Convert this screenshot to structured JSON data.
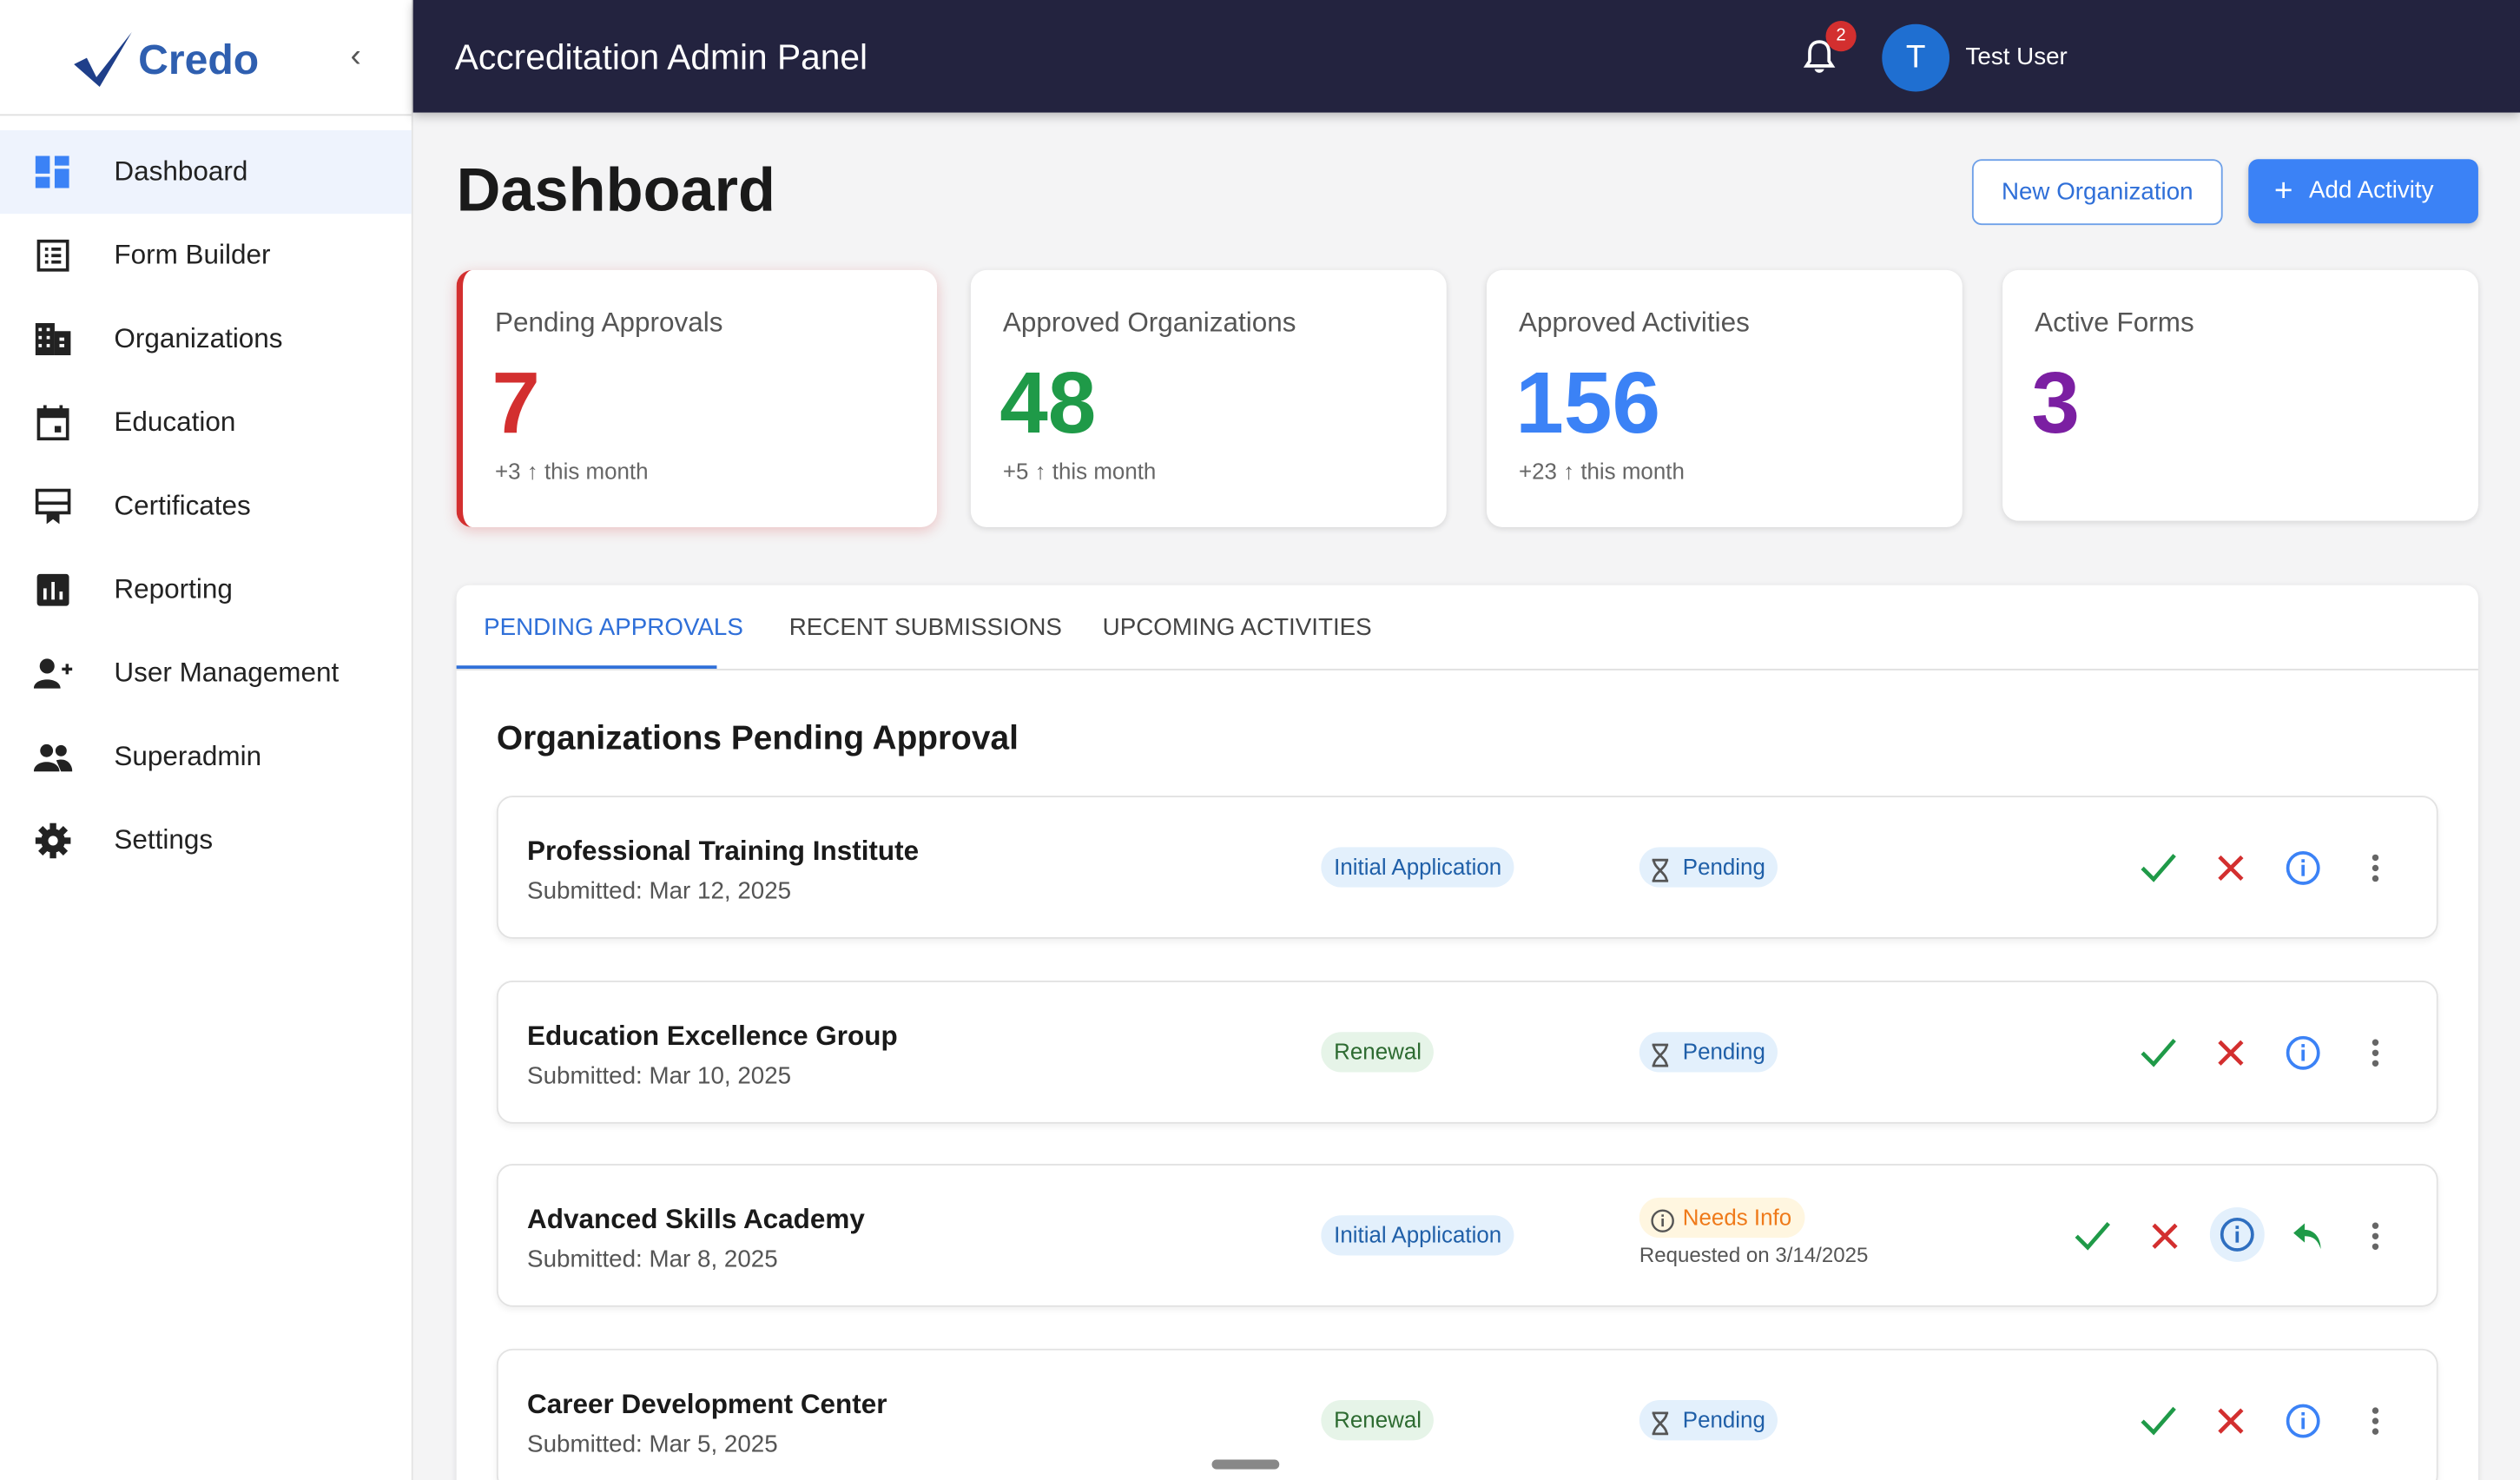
{
  "brand": {
    "name": "Credo"
  },
  "header": {
    "title": "Accreditation Admin Panel",
    "notifications": "2",
    "avatar_initial": "T",
    "user_name": "Test User"
  },
  "sidebar": {
    "items": [
      {
        "label": "Dashboard",
        "icon": "dashboard-icon",
        "active": true
      },
      {
        "label": "Form Builder",
        "icon": "form-icon"
      },
      {
        "label": "Organizations",
        "icon": "building-icon"
      },
      {
        "label": "Education",
        "icon": "calendar-icon"
      },
      {
        "label": "Certificates",
        "icon": "certificate-icon"
      },
      {
        "label": "Reporting",
        "icon": "chart-icon"
      },
      {
        "label": "User Management",
        "icon": "add-user-icon"
      },
      {
        "label": "Superadmin",
        "icon": "people-icon"
      },
      {
        "label": "Settings",
        "icon": "gear-icon"
      }
    ]
  },
  "page": {
    "title": "Dashboard",
    "new_org_label": "New Organization",
    "add_activity_label": "Add Activity"
  },
  "stats": [
    {
      "title": "Pending Approvals",
      "value": "7",
      "delta": "+3",
      "suffix": "this month",
      "color": "#d32f2f"
    },
    {
      "title": "Approved Organizations",
      "value": "48",
      "delta": "+5",
      "suffix": "this month",
      "color": "#1f9a48"
    },
    {
      "title": "Approved Activities",
      "value": "156",
      "delta": "+23",
      "suffix": "this month",
      "color": "#3b82f6"
    },
    {
      "title": "Active Forms",
      "value": "3",
      "color": "#7b1fa2"
    }
  ],
  "tabs": [
    "PENDING APPROVALS",
    "RECENT SUBMISSIONS",
    "UPCOMING ACTIVITIES"
  ],
  "section_title": "Organizations Pending Approval",
  "rows": [
    {
      "name": "Professional Training Institute",
      "submitted": "Submitted: Mar 12, 2025",
      "type": "Initial Application",
      "status": "Pending"
    },
    {
      "name": "Education Excellence Group",
      "submitted": "Submitted: Mar 10, 2025",
      "type": "Renewal",
      "status": "Pending"
    },
    {
      "name": "Advanced Skills Academy",
      "submitted": "Submitted: Mar 8, 2025",
      "type": "Initial Application",
      "status": "Needs Info",
      "requested": "Requested on 3/14/2025"
    },
    {
      "name": "Career Development Center",
      "submitted": "Submitted: Mar 5, 2025",
      "type": "Renewal",
      "status": "Pending"
    }
  ]
}
